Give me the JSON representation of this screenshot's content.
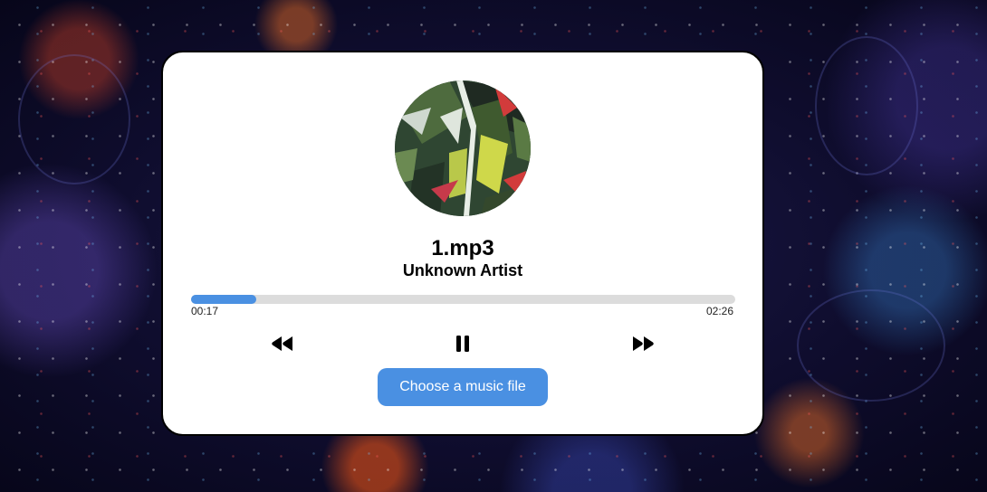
{
  "player": {
    "track_title": "1.mp3",
    "artist": "Unknown Artist",
    "current_time": "00:17",
    "total_time": "02:26",
    "progress_fraction": 0.12,
    "accent_color": "#4a90e2",
    "controls": {
      "rewind_icon": "rewind-icon",
      "pause_icon": "pause-icon",
      "forward_icon": "fast-forward-icon"
    },
    "choose_file_label": "Choose a music file"
  }
}
